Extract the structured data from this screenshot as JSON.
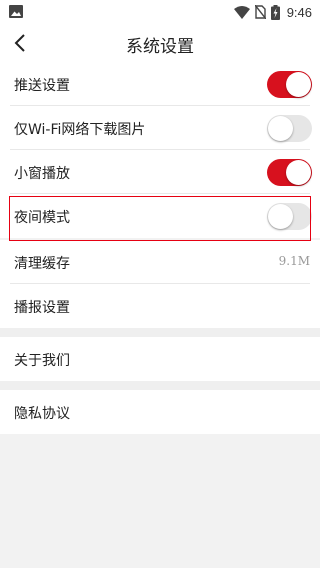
{
  "status": {
    "time": "9:46"
  },
  "header": {
    "title": "系统设置"
  },
  "settings": [
    {
      "label": "推送设置",
      "toggle": "on"
    },
    {
      "label": "仅Wi-Fi网络下载图片",
      "toggle": "off"
    },
    {
      "label": "小窗播放",
      "toggle": "on"
    },
    {
      "label": "夜间模式",
      "toggle": "off"
    },
    {
      "label": "清理缓存",
      "value": "9.1M"
    },
    {
      "label": "播报设置"
    }
  ],
  "about": {
    "label": "关于我们"
  },
  "privacy": {
    "label": "隐私协议"
  },
  "colors": {
    "accent": "#d7111e",
    "highlight_border": "#e60012",
    "background": "#f2f2f2"
  }
}
